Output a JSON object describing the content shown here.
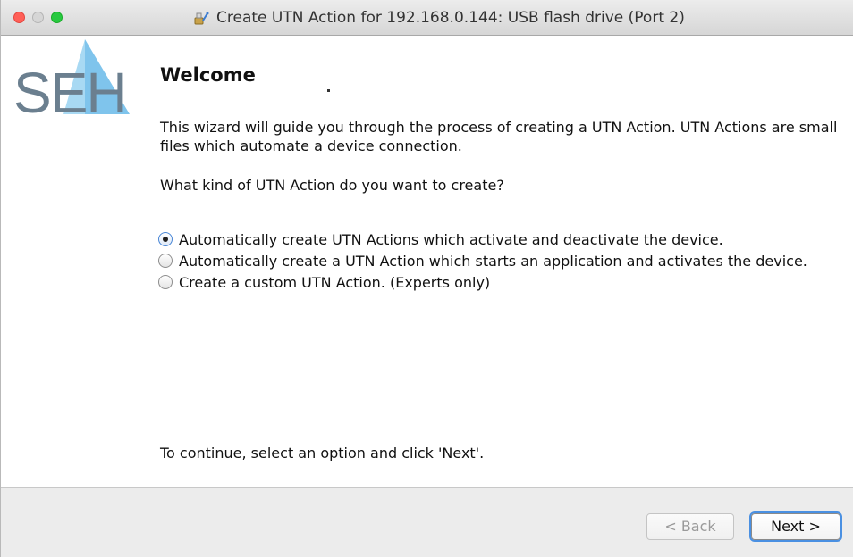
{
  "window": {
    "title": "Create UTN Action for 192.168.0.144: USB flash drive (Port 2)"
  },
  "logo": {
    "text": "SEH",
    "color": "#6b7f8f",
    "accent_color": "#7fc4ec"
  },
  "wizard": {
    "heading": "Welcome",
    "description": "This wizard will guide you through the process of creating a UTN Action. UTN Actions are small files which automate a device connection.",
    "question": "What kind of UTN Action do you want to create?",
    "options": [
      {
        "label": "Automatically create UTN Actions which activate and deactivate the device.",
        "selected": true
      },
      {
        "label": "Automatically create a UTN Action which starts an application and activates the device.",
        "selected": false
      },
      {
        "label": "Create a custom UTN Action. (Experts only)",
        "selected": false
      }
    ],
    "footnote": "To continue, select an option and click 'Next'."
  },
  "buttons": {
    "back_label": "< Back",
    "next_label": "Next >"
  }
}
